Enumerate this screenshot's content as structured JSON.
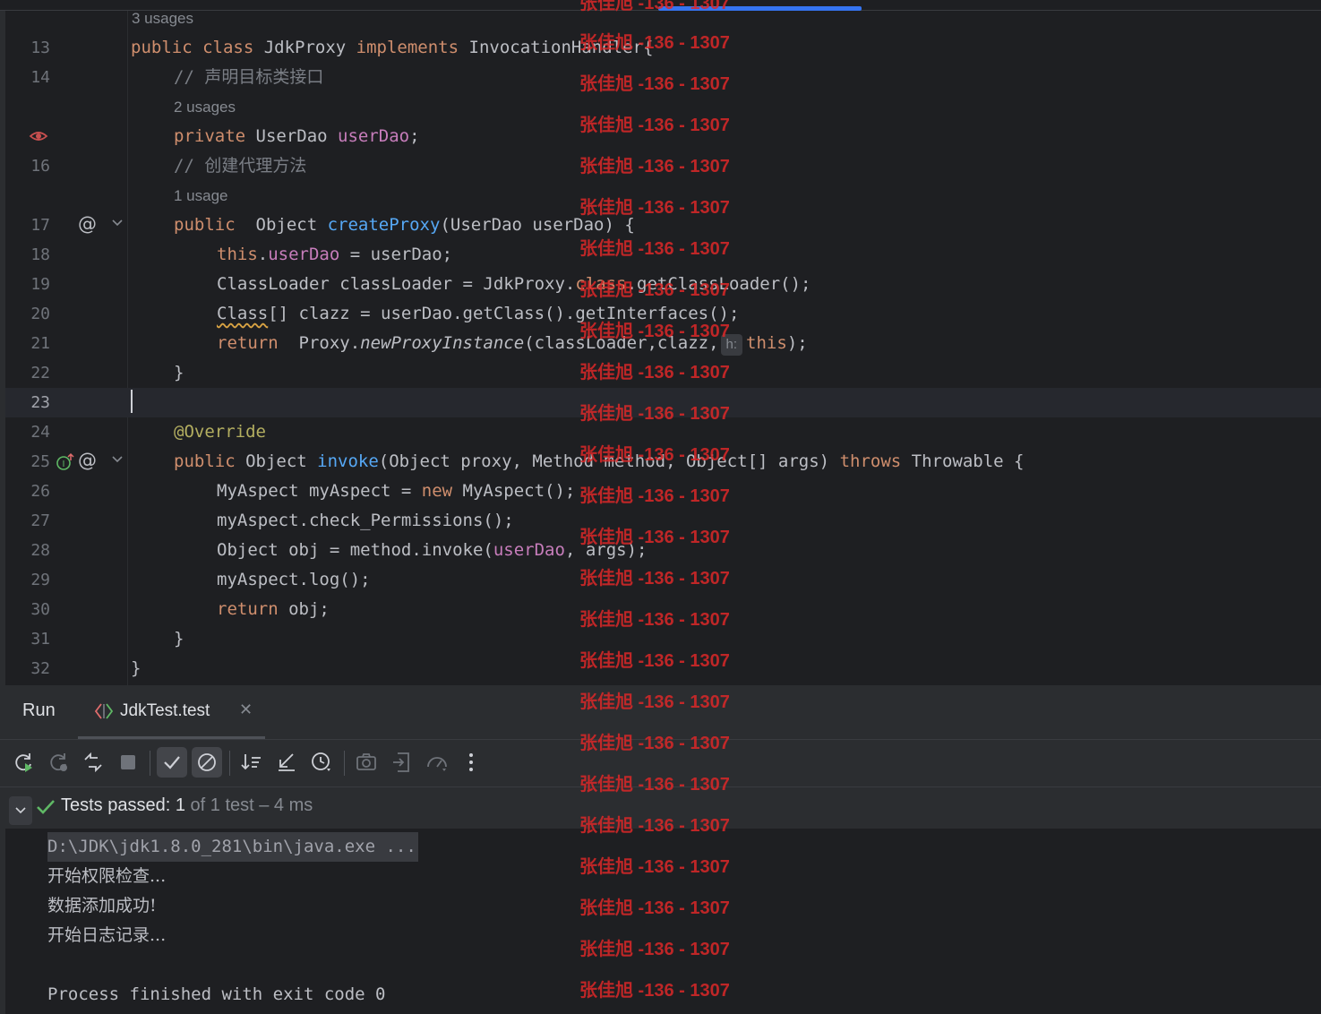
{
  "editor": {
    "usages": {
      "class_usages": "3 usages",
      "field_usages": "2 usages",
      "method_usages": "1 usage"
    },
    "line_numbers": {
      "l13": "13",
      "l14": "14",
      "l16": "16",
      "l17": "17",
      "l18": "18",
      "l19": "19",
      "l20": "20",
      "l21": "21",
      "l22": "22",
      "l23": "23",
      "l24": "24",
      "l25": "25",
      "l26": "26",
      "l27": "27",
      "l28": "28",
      "l29": "29",
      "l30": "30",
      "l31": "31",
      "l32": "32"
    },
    "code": {
      "l13": {
        "kw1": "public class ",
        "name": "JdkProxy ",
        "kw2": "implements ",
        "iface": "InvocationHandler{"
      },
      "l14": {
        "comment": "// 声明目标类接口"
      },
      "l15": {
        "kw": "private ",
        "type": "UserDao ",
        "field": "userDao",
        "end": ";"
      },
      "l16": {
        "comment": "// 创建代理方法"
      },
      "l17": {
        "kw": "public  ",
        "type": "Object ",
        "fn": "createProxy",
        "rest": "(UserDao userDao) {"
      },
      "l18": {
        "kw": "this",
        "dot": ".",
        "field": "userDao",
        "rest": " = userDao;"
      },
      "l19": {
        "text": "ClassLoader classLoader = JdkProxy.",
        "kw": "class",
        "rest": ".getClassLoader();"
      },
      "l20": {
        "cls": "Class",
        "rest": "[] clazz = userDao.getClass().getInterfaces();"
      },
      "l21": {
        "kw": "return  ",
        "pre": "Proxy.",
        "fn": "newProxyInstance",
        "args": "(classLoader,clazz,",
        "hint": "h:",
        "kw2": "this",
        "end": ");"
      },
      "l22": {
        "text": "}"
      },
      "l24": {
        "ann": "@Override"
      },
      "l25": {
        "kw": "public ",
        "type": "Object ",
        "fn": "invoke",
        "params": "(Object proxy, Method method, Object[] args) ",
        "kw2": "throws ",
        "rest": "Throwable {"
      },
      "l26": {
        "pre": "MyAspect myAspect = ",
        "kw": "new ",
        "rest": "MyAspect();"
      },
      "l27": {
        "text": "myAspect.check_Permissions();"
      },
      "l28": {
        "pre": "Object obj = method.invoke(",
        "field": "userDao",
        "rest": ", args);"
      },
      "l29": {
        "text": "myAspect.log();"
      },
      "l30": {
        "kw": "return ",
        "rest": "obj;"
      },
      "l31": {
        "text": "}"
      },
      "l32": {
        "text": "}"
      }
    }
  },
  "run_panel": {
    "title": "Run",
    "tab_label": "JdkTest.test",
    "tests_passed_label": "Tests passed: ",
    "tests_passed_count": "1",
    "tests_passed_rest": " of 1 test – 4 ms",
    "console": {
      "command": "D:\\JDK\\jdk1.8.0_281\\bin\\java.exe ...",
      "line1": "开始权限检查...",
      "line2": "数据添加成功!",
      "line3": "开始日志记录...",
      "exit": "Process finished with exit code 0"
    }
  },
  "watermark": {
    "text": "张佳旭 -136 - 1307"
  },
  "colors": {
    "editor_bg": "#1e1f22",
    "panel_bg": "#2b2d30",
    "keyword": "#cf8e6d",
    "field": "#c77dbb",
    "function": "#56a8f5",
    "annotation": "#b3ae60",
    "success": "#5fb865",
    "watermark": "#dc2828",
    "accent": "#3574f0"
  },
  "icons": {
    "gutter": [
      "eye-icon",
      "at-implements-icon",
      "override-up-icon",
      "fold-chevron-icon"
    ],
    "toolbar": [
      "rerun-icon",
      "rerun-failed-icon",
      "toggle-auto-test-icon",
      "stop-icon",
      "show-passed-icon",
      "show-ignored-icon",
      "sort-icon",
      "collapse-icon",
      "history-icon",
      "screenshot-icon",
      "export-icon",
      "coverage-icon",
      "more-icon"
    ]
  }
}
